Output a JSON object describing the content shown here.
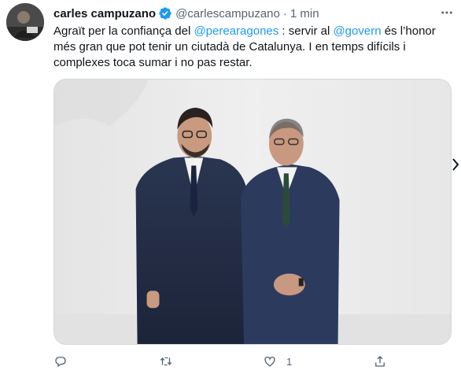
{
  "tweet": {
    "author_name": "carles campuzano",
    "handle": "@carlescampuzano",
    "separator": "·",
    "time": "1 min",
    "text_parts": {
      "p1": "Agraït per la confiança del ",
      "mention1": "@perearagones",
      "p2": " : servir al ",
      "mention2": "@govern",
      "p3": " és l’honor més gran que pot tenir un ciutadà de Catalunya. I en temps difícils i complexes toca sumar i no pas restar."
    },
    "media_description": "photo-two-men-in-suits",
    "actions": {
      "reply_count": "",
      "retweet_count": "",
      "like_count": "1",
      "share_count": ""
    }
  },
  "colors": {
    "link": "#1d9bf0",
    "secondary_text": "#536471",
    "verified": "#1d9bf0"
  }
}
